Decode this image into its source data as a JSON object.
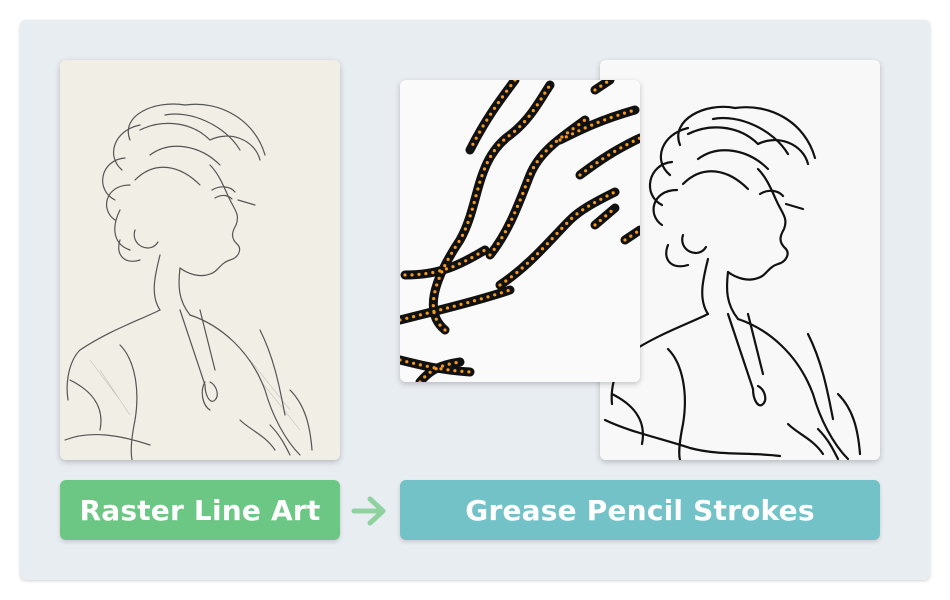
{
  "labels": {
    "source": "Raster Line Art",
    "target": "Grease Pencil Strokes"
  },
  "icons": {
    "arrow": "arrow-right-icon"
  },
  "colors": {
    "panel_background": "#e8edf2",
    "source_label": "#6cc784",
    "target_label": "#72c2c8",
    "arrow": "#8fd29f",
    "stroke_points": "#f29a1e",
    "ink": "#111111"
  }
}
